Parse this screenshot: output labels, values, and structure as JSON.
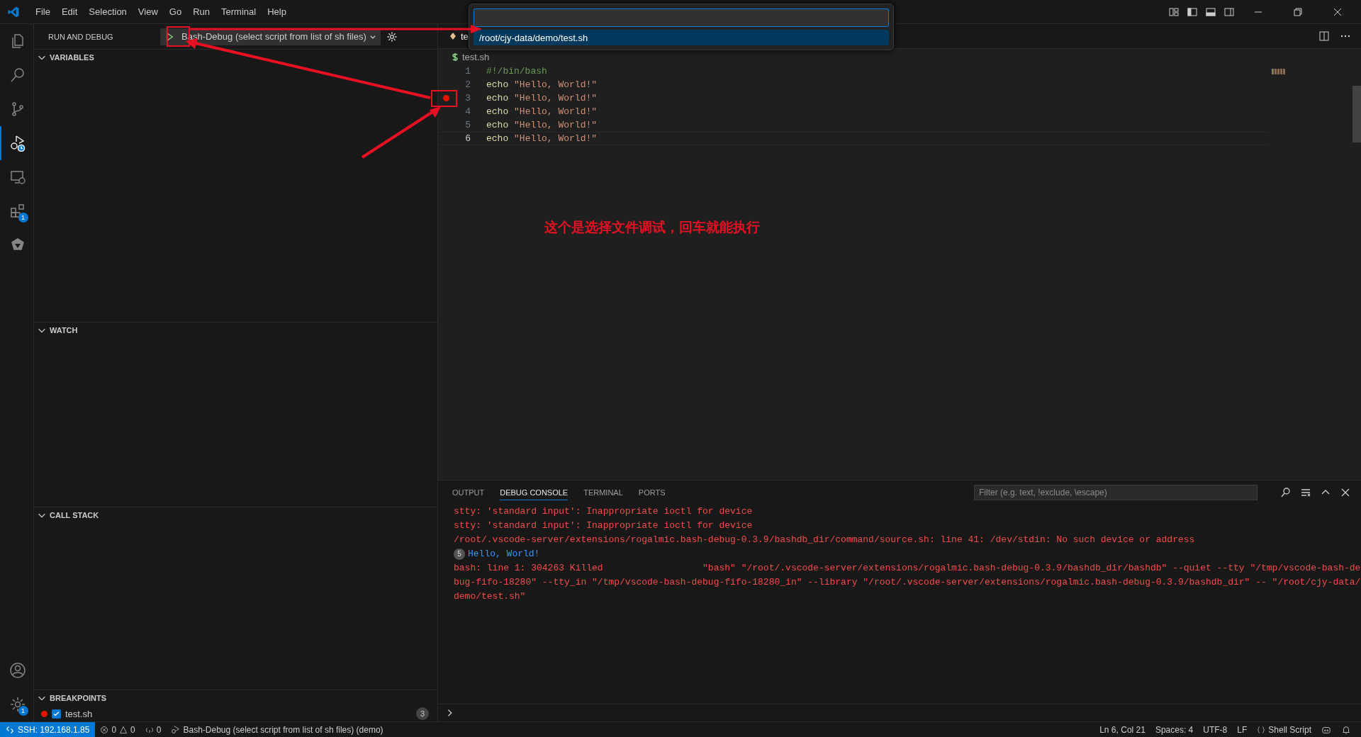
{
  "menu": [
    "File",
    "Edit",
    "Selection",
    "View",
    "Go",
    "Run",
    "Terminal",
    "Help"
  ],
  "activity_bar": [
    {
      "kind": "explorer",
      "selected": false
    },
    {
      "kind": "search",
      "selected": false
    },
    {
      "kind": "source-control",
      "selected": false
    },
    {
      "kind": "run-debug",
      "selected": true
    },
    {
      "kind": "remote",
      "selected": false
    },
    {
      "kind": "extensions",
      "selected": false,
      "badge": "1"
    },
    {
      "kind": "ai",
      "selected": false
    }
  ],
  "activity_bottom": [
    {
      "kind": "account"
    },
    {
      "kind": "manage",
      "badge": "1"
    }
  ],
  "sidebar": {
    "title": "RUN AND DEBUG",
    "config": "Bash-Debug (select script from list of sh files)",
    "sections": [
      {
        "title": "VARIABLES",
        "expanded": true
      },
      {
        "title": "WATCH",
        "expanded": true
      },
      {
        "title": "CALL STACK",
        "expanded": true
      }
    ],
    "breakpoints": {
      "title": "BREAKPOINTS",
      "expanded": true,
      "items": [
        {
          "label": "test.sh",
          "checked": true,
          "count": "3"
        }
      ]
    }
  },
  "quick_pick": {
    "items": [
      {
        "label": "/root/cjy-data/demo/test.sh",
        "selected": true
      }
    ]
  },
  "editor": {
    "tab": "te",
    "breadcrumb": "test.sh",
    "lines": [
      {
        "number": "1",
        "breakpoint": false,
        "current": false,
        "parts": [
          {
            "kind": "comment",
            "text": "#!/bin/bash"
          }
        ]
      },
      {
        "number": "2",
        "breakpoint": false,
        "current": false,
        "parts": [
          {
            "kind": "command",
            "text": "echo"
          },
          {
            "kind": "string",
            "text": "\"Hello, World!\""
          }
        ]
      },
      {
        "number": "3",
        "breakpoint": true,
        "current": false,
        "parts": [
          {
            "kind": "command",
            "text": "echo"
          },
          {
            "kind": "string",
            "text": "\"Hello, World!\""
          }
        ]
      },
      {
        "number": "4",
        "breakpoint": false,
        "current": false,
        "parts": [
          {
            "kind": "command",
            "text": "echo"
          },
          {
            "kind": "string",
            "text": "\"Hello, World!\""
          }
        ]
      },
      {
        "number": "5",
        "breakpoint": false,
        "current": false,
        "parts": [
          {
            "kind": "command",
            "text": "echo"
          },
          {
            "kind": "string",
            "text": "\"Hello, World!\""
          }
        ]
      },
      {
        "number": "6",
        "breakpoint": false,
        "current": true,
        "parts": [
          {
            "kind": "command",
            "text": "echo"
          },
          {
            "kind": "string",
            "text": "\"Hello, World!\""
          }
        ]
      }
    ]
  },
  "annotation": "这个是选择文件调试，回车就能执行",
  "panel": {
    "tabs": [
      {
        "label": "OUTPUT",
        "selected": false
      },
      {
        "label": "DEBUG CONSOLE",
        "selected": true
      },
      {
        "label": "TERMINAL",
        "selected": false
      },
      {
        "label": "PORTS",
        "selected": false
      }
    ],
    "filter_placeholder": "Filter (e.g. text, !exclude, \\escape)",
    "lines": [
      {
        "kind": "error",
        "text": "stty: 'standard input': Inappropriate ioctl for device"
      },
      {
        "kind": "error",
        "text": "stty: 'standard input': Inappropriate ioctl for device"
      },
      {
        "kind": "error",
        "text": "/root/.vscode-server/extensions/rogalmic.bash-debug-0.3.9/bashdb_dir/command/source.sh: line 41: /dev/stdin: No such device or address"
      },
      {
        "kind": "output",
        "count": "5",
        "text": "Hello, World!"
      },
      {
        "kind": "error",
        "text": "bash: line 1: 304263 Killed                  \"bash\" \"/root/.vscode-server/extensions/rogalmic.bash-debug-0.3.9/bashdb_dir/bashdb\" --quiet --tty \"/tmp/vscode-bash-debug-fifo-18280\" --tty_in \"/tmp/vscode-bash-debug-fifo-18280_in\" --library \"/root/.vscode-server/extensions/rogalmic.bash-debug-0.3.9/bashdb_dir\" -- \"/root/cjy-data/demo/test.sh\""
      }
    ]
  },
  "status_bar": {
    "remote": "SSH: 192.168.1.85",
    "errors": "0",
    "warnings": "0",
    "ports": "0",
    "launch": "Bash-Debug (select script from list of sh files) (demo)",
    "cursor": "Ln 6, Col 21",
    "indent": "Spaces: 4",
    "encoding": "UTF-8",
    "eol": "LF",
    "language": "Shell Script"
  }
}
